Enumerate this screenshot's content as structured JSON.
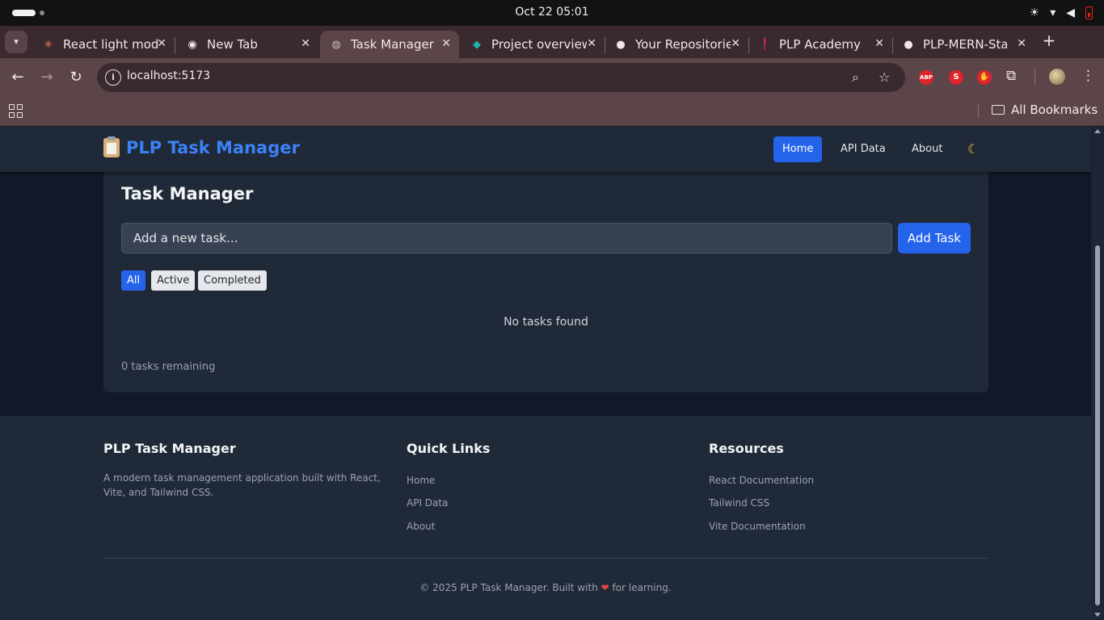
{
  "os": {
    "clock": "Oct 22  05:01"
  },
  "browser": {
    "tabs": [
      {
        "label": "React light mode",
        "icon": "react-favicon"
      },
      {
        "label": "New Tab",
        "icon": "chrome-favicon"
      },
      {
        "label": "Task Manager",
        "icon": "globe-favicon"
      },
      {
        "label": "Project overview",
        "icon": "diamond-favicon"
      },
      {
        "label": "Your Repositories",
        "icon": "github-favicon"
      },
      {
        "label": "PLP Academy",
        "icon": "plp-favicon"
      },
      {
        "label": "PLP-MERN-Stack",
        "icon": "github-favicon"
      }
    ],
    "url": "localhost:5173",
    "bookmarks_label": "All Bookmarks",
    "extensions": [
      {
        "label": "ABP",
        "color": "#e0242c"
      },
      {
        "label": "S",
        "color": "#e0242c"
      },
      {
        "label": "✋",
        "color": "#e0242c"
      }
    ]
  },
  "app": {
    "brand": "PLP Task Manager",
    "nav": [
      {
        "label": "Home",
        "active": true
      },
      {
        "label": "API Data",
        "active": false
      },
      {
        "label": "About",
        "active": false
      }
    ],
    "theme_toggle_icon": "moon-icon",
    "accent": "#2563eb"
  },
  "task_card": {
    "title": "Task Manager",
    "input_placeholder": "Add a new task...",
    "add_button": "Add Task",
    "filters": [
      "All",
      "Active",
      "Completed"
    ],
    "active_filter": "All",
    "empty_message": "No tasks found",
    "remaining": "0 tasks remaining"
  },
  "footer": {
    "about_title": "PLP Task Manager",
    "about_text": "A modern task management application built with React, Vite, and Tailwind CSS.",
    "quick_links_title": "Quick Links",
    "quick_links": [
      "Home",
      "API Data",
      "About"
    ],
    "resources_title": "Resources",
    "resources": [
      "React Documentation",
      "Tailwind CSS",
      "Vite Documentation"
    ],
    "copyright_pre": "© 2025 PLP Task Manager. Built with",
    "copyright_post": "for learning."
  }
}
